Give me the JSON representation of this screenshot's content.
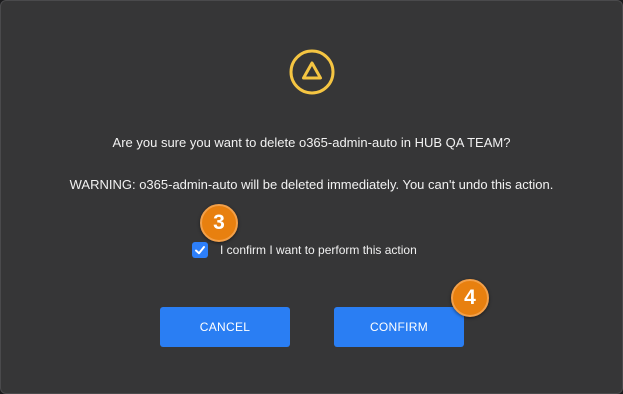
{
  "dialog": {
    "icon": "warning-triangle-icon",
    "question": "Are you sure you want to delete o365-admin-auto in HUB QA TEAM?",
    "warning": "WARNING: o365-admin-auto will be deleted immediately. You can't undo this action.",
    "confirm_checkbox": {
      "label": "I confirm I want to perform this action",
      "checked": true
    },
    "buttons": {
      "cancel": "CANCEL",
      "confirm": "CONFIRM"
    }
  },
  "annotations": {
    "step_3": "3",
    "step_4": "4"
  },
  "colors": {
    "background": "#363637",
    "accent": "#2a7ef3",
    "warning": "#f5c542",
    "badge": "#e8800f"
  }
}
